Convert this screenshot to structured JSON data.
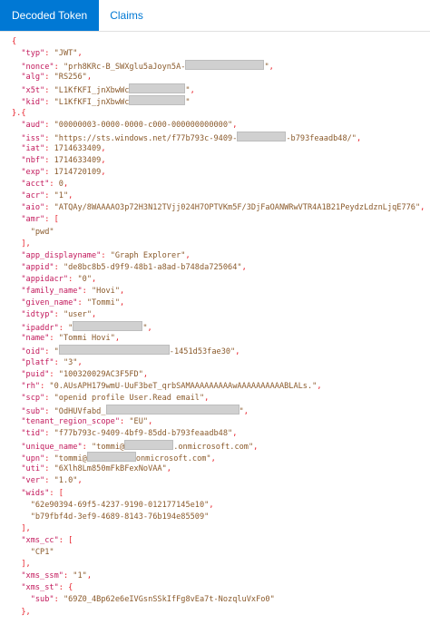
{
  "tabs": [
    {
      "label": "Decoded Token",
      "active": true
    },
    {
      "label": "Claims",
      "active": false
    }
  ],
  "header_claims": [
    {
      "key": "typ",
      "pre": "JWT",
      "redact_w": 0,
      "post": ""
    },
    {
      "key": "nonce",
      "pre": "prh8KRc-B_SWXglu5aJoyn5A-",
      "redact_w": 85,
      "post": ""
    },
    {
      "key": "alg",
      "pre": "RS256",
      "redact_w": 0,
      "post": ""
    },
    {
      "key": "x5t",
      "pre": "L1KfKFI_jnXbwWc",
      "redact_w": 60,
      "post": ""
    },
    {
      "key": "kid",
      "pre": "L1KfKFI_jnXbwWc",
      "redact_w": 60,
      "post": ""
    }
  ],
  "payload_lines": [
    {
      "key": "aud",
      "kind": "str",
      "pre": "00000003-0000-0000-c000-000000000000",
      "redact_w": 0,
      "post": ""
    },
    {
      "key": "iss",
      "kind": "str",
      "pre": "https://sts.windows.net/f77b793c-9409-",
      "redact_w": 52,
      "post": "-b793feaadb48/"
    },
    {
      "key": "iat",
      "kind": "num",
      "pre": "1714633409"
    },
    {
      "key": "nbf",
      "kind": "num",
      "pre": "1714633409"
    },
    {
      "key": "exp",
      "kind": "num",
      "pre": "1714720109"
    },
    {
      "key": "acct",
      "kind": "num",
      "pre": "0"
    },
    {
      "key": "acr",
      "kind": "str",
      "pre": "1",
      "redact_w": 0,
      "post": ""
    },
    {
      "key": "aio",
      "kind": "str",
      "pre": "ATQAy/8WAAAAO3p72H3N12TVjj024H7OPTVKm5F/3DjFaOANWRwVTR4A1B21PeydzLdznLjqE776",
      "redact_w": 0,
      "post": ""
    },
    {
      "key": "amr",
      "kind": "open",
      "bracket": "["
    },
    {
      "kind": "item",
      "pre": "pwd",
      "redact_w": 0,
      "post": ""
    },
    {
      "kind": "close",
      "bracket": "]"
    },
    {
      "key": "app_displayname",
      "kind": "str",
      "pre": "Graph Explorer",
      "redact_w": 0,
      "post": ""
    },
    {
      "key": "appid",
      "kind": "str",
      "pre": "de8bc8b5-d9f9-48b1-a8ad-b748da725064",
      "redact_w": 0,
      "post": ""
    },
    {
      "key": "appidacr",
      "kind": "str",
      "pre": "0",
      "redact_w": 0,
      "post": ""
    },
    {
      "key": "family_name",
      "kind": "str",
      "pre": "Hovi",
      "redact_w": 0,
      "post": ""
    },
    {
      "key": "given_name",
      "kind": "str",
      "pre": "Tommi",
      "redact_w": 0,
      "post": ""
    },
    {
      "key": "idtyp",
      "kind": "str",
      "pre": "user",
      "redact_w": 0,
      "post": ""
    },
    {
      "key": "ipaddr",
      "kind": "str",
      "pre": "",
      "redact_w": 75,
      "post": ""
    },
    {
      "key": "name",
      "kind": "str",
      "pre": "Tommi Hovi",
      "redact_w": 0,
      "post": ""
    },
    {
      "key": "oid",
      "kind": "str",
      "pre": "",
      "redact_w": 120,
      "post": "-1451d53fae30"
    },
    {
      "key": "platf",
      "kind": "str",
      "pre": "3",
      "redact_w": 0,
      "post": ""
    },
    {
      "key": "puid",
      "kind": "str",
      "pre": "100320029AC3F5FD",
      "redact_w": 0,
      "post": ""
    },
    {
      "key": "rh",
      "kind": "str",
      "pre": "0.AUsAPH179wmU-UuF3beT_qrbSAMAAAAAAAAAwAAAAAAAAAABLALs.",
      "redact_w": 0,
      "post": ""
    },
    {
      "key": "scp",
      "kind": "str",
      "pre": "openid profile User.Read email",
      "redact_w": 0,
      "post": ""
    },
    {
      "key": "sub",
      "kind": "str",
      "pre": "OdHUVfabd_",
      "redact_w": 145,
      "post": ""
    },
    {
      "key": "tenant_region_scope",
      "kind": "str",
      "pre": "EU",
      "redact_w": 0,
      "post": ""
    },
    {
      "key": "tid",
      "kind": "str",
      "pre": "f77b793c-9409-4bf9-85dd-b793feaadb48",
      "redact_w": 0,
      "post": ""
    },
    {
      "key": "unique_name",
      "kind": "str",
      "pre": "tommi@",
      "redact_w": 52,
      "post": ".onmicrosoft.com"
    },
    {
      "key": "upn",
      "kind": "str",
      "pre": "tommi@",
      "redact_w": 52,
      "post": "onmicrosoft.com"
    },
    {
      "key": "uti",
      "kind": "str",
      "pre": "6Xlh8Lm850mFkBFexNoVAA",
      "redact_w": 0,
      "post": ""
    },
    {
      "key": "ver",
      "kind": "str",
      "pre": "1.0",
      "redact_w": 0,
      "post": ""
    },
    {
      "key": "wids",
      "kind": "open",
      "bracket": "["
    },
    {
      "kind": "item",
      "pre": "62e90394-69f5-4237-9190-012177145e10",
      "redact_w": 0,
      "post": "",
      "comma": true
    },
    {
      "kind": "item",
      "pre": "b79fbf4d-3ef9-4689-8143-76b194e85509",
      "redact_w": 0,
      "post": ""
    },
    {
      "kind": "close",
      "bracket": "]"
    },
    {
      "key": "xms_cc",
      "kind": "open",
      "bracket": "["
    },
    {
      "kind": "item",
      "pre": "CP1",
      "redact_w": 0,
      "post": ""
    },
    {
      "kind": "close",
      "bracket": "]"
    },
    {
      "key": "xms_ssm",
      "kind": "str",
      "pre": "1",
      "redact_w": 0,
      "post": ""
    },
    {
      "key": "xms_st",
      "kind": "open",
      "bracket": "{"
    },
    {
      "key": "sub",
      "kind": "str",
      "indent": 2,
      "pre": "69Z0_4Bp62e6eIVGsnSSkIfFg8vEa7t-NozqluVxFo0",
      "redact_w": 0,
      "post": "",
      "nocomma": true
    },
    {
      "kind": "close",
      "bracket": "},"
    }
  ],
  "colors": {
    "accent": "#0078d4",
    "key": "#c2185b",
    "punct": "#e8202a",
    "string": "#8a5a2b"
  }
}
